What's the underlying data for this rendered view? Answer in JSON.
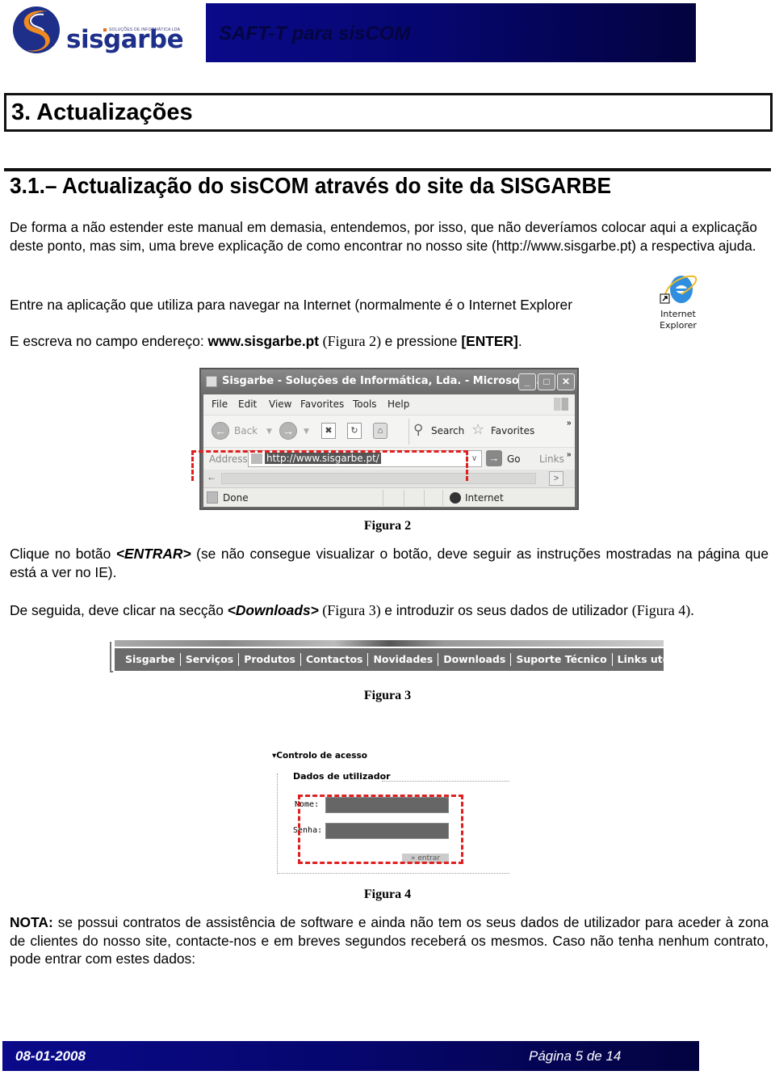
{
  "header": {
    "logo_word": "sisgarbe",
    "logo_tagline": "SOLUÇÕES DE INFORMÁTICA LDA",
    "title": "SAFT-T para sisCOM",
    "brand_colors": {
      "band": "#06066e",
      "logo_blue": "#1e2f8a",
      "logo_orange": "#f08a1e"
    }
  },
  "chapter": {
    "title": "3. Actualizações"
  },
  "section": {
    "title": "3.1.–  Actualização do sisCOM através do site da SISGARBE"
  },
  "paragraphs": {
    "intro": "De forma a não estender este manual em demasia, entendemos, por isso, que não deveríamos colocar aqui a explicação deste ponto, mas sim, uma breve explicação de como encontrar no nosso site (http://www.sisgarbe.pt) a respectiva ajuda.",
    "enter_app": "Entre na aplicação que utiliza para navegar na Internet (normalmente é o Internet Explorer",
    "type_address_prefix": "E escreva no campo endereço: ",
    "type_address_url": "www.sisgarbe.pt",
    "type_address_ref": " (Figura 2) ",
    "type_address_mid": "e pressione ",
    "type_address_key": "[ENTER]",
    "type_address_end": ".",
    "click_prefix": "Clique no botão ",
    "click_button": "<ENTRAR>",
    "click_suffix": " (se não consegue visualizar o botão, deve seguir as instruções mostradas na página que está a ver no IE).",
    "downloads_prefix": "De seguida, deve clicar na secção ",
    "downloads_section": "<Downloads>",
    "downloads_ref1": " (Figura 3) ",
    "downloads_mid": "e introduzir os seus dados de utilizador ",
    "downloads_ref2": "(Figura 4).",
    "note_label": "NOTA:",
    "note_text": " se possui contratos de assistência de software e ainda não tem os seus dados de utilizador para aceder à zona de clientes do nosso site, contacte-nos e em breves segundos receberá os mesmos. Caso não tenha nenhum contrato, pode entrar com estes dados:"
  },
  "ie_icon": {
    "label_line1": "Internet",
    "label_line2": "Explorer"
  },
  "browser": {
    "title": "Sisgarbe - Soluções de Informática, Lda. - Microsoft I...",
    "window_buttons": [
      "_",
      "□",
      "✕"
    ],
    "menu": [
      "File",
      "Edit",
      "View",
      "Favorites",
      "Tools",
      "Help"
    ],
    "toolbar": {
      "back": "Back",
      "search": "Search",
      "favorites": "Favorites"
    },
    "address_label": "Address",
    "address_value": "http://www.sisgarbe.pt/",
    "go": "Go",
    "links": "Links",
    "status": "Done",
    "zone": "Internet"
  },
  "nav_menu": [
    "Sisgarbe",
    "Serviços",
    "Produtos",
    "Contactos",
    "Novidades",
    "Downloads",
    "Suporte Técnico",
    "Links utéis"
  ],
  "login": {
    "section": "Controlo de acesso",
    "title": "Dados de utilizador",
    "name_label": "Nome:",
    "password_label": "Senha:",
    "name_value": "",
    "password_value": "",
    "submit": "» entrar"
  },
  "captions": {
    "fig2": "Figura 2",
    "fig3": "Figura 3",
    "fig4": "Figura 4"
  },
  "footer": {
    "date": "08-01-2008",
    "page": "Página 5 de 14"
  }
}
